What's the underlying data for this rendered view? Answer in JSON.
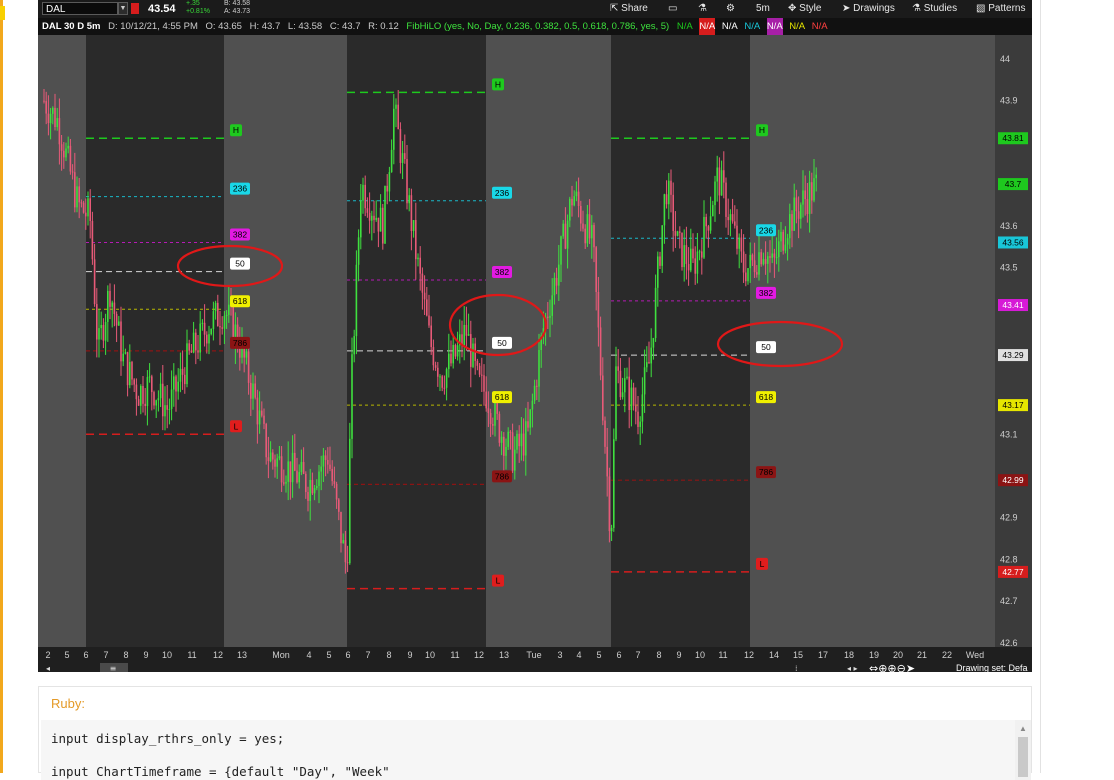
{
  "toolbar": {
    "symbol": "DAL",
    "last_price": "43.54",
    "net_change": "+.35",
    "net_change_pct": "+0.81%",
    "bid": "B: 43.58",
    "ask": "A: 43.73",
    "share_label": "Share",
    "timeframe_label": "5m",
    "style_label": "Style",
    "drawings_label": "Drawings",
    "studies_label": "Studies",
    "patterns_label": "Patterns"
  },
  "status_line": {
    "aggregation": "DAL 30 D 5m",
    "date": "D: 10/12/21, 4:55 PM",
    "open": "O: 43.65",
    "high": "H: 43.7",
    "low": "L: 43.58",
    "close": "C: 43.7",
    "range": "R: 0.12",
    "study": "FibHiLO (yes, No, Day, 0.236, 0.382, 0.5, 0.618, 0.786, yes, 5)",
    "na_values": [
      "N/A",
      "N/A",
      "N/A",
      "N/A",
      "N/A",
      "N/A",
      "N/A"
    ]
  },
  "chart_data": {
    "type": "candlestick",
    "symbol": "DAL",
    "ylim": [
      42.6,
      44.0
    ],
    "y_ticks": [
      "44",
      "43.9",
      "43.6",
      "43.5",
      "43.1",
      "42.9",
      "42.8",
      "42.7",
      "42.6"
    ],
    "price_badges": [
      {
        "label": "43.81",
        "color": "#1ec91e"
      },
      {
        "label": "43.7",
        "color": "#1ec91e"
      },
      {
        "label": "43.56",
        "color": "#19c6d8"
      },
      {
        "label": "43.41",
        "color": "#d61ad6"
      },
      {
        "label": "43.29",
        "color": "#e0e0e0"
      },
      {
        "label": "43.17",
        "color": "#e6e600"
      },
      {
        "label": "42.99",
        "color": "#8b1414"
      },
      {
        "label": "42.77",
        "color": "#d61d1d"
      }
    ],
    "x_tick_labels": [
      "2",
      "5",
      "6",
      "7",
      "8",
      "9",
      "10",
      "11",
      "12",
      "13",
      "Mon",
      "4",
      "5",
      "6",
      "7",
      "8",
      "9",
      "10",
      "11",
      "12",
      "13",
      "Tue",
      "3",
      "4",
      "5",
      "6",
      "7",
      "8",
      "9",
      "10",
      "11",
      "12",
      "14",
      "15",
      "17",
      "18",
      "19",
      "20",
      "21",
      "22",
      "Wed"
    ],
    "fib_levels": [
      {
        "day": 1,
        "high": 43.81,
        "r236": 43.67,
        "r382": 43.56,
        "r50": 43.49,
        "r618": 43.4,
        "r786": 43.3,
        "low": 43.1,
        "labels": [
          "H",
          "236",
          "382",
          "50",
          "618",
          "786",
          "L"
        ]
      },
      {
        "day": 2,
        "high": 43.92,
        "r236": 43.66,
        "r382": 43.47,
        "r50": 43.3,
        "r618": 43.17,
        "r786": 42.98,
        "low": 42.73,
        "labels": [
          "H",
          "236",
          "382",
          "50",
          "618",
          "786",
          "L"
        ]
      },
      {
        "day": 3,
        "high": 43.81,
        "r236": 43.57,
        "r382": 43.42,
        "r50": 43.29,
        "r618": 43.17,
        "r786": 42.99,
        "low": 42.77,
        "labels": [
          "H",
          "236",
          "382",
          "50",
          "618",
          "786",
          "L"
        ]
      }
    ],
    "day_sessions": [
      {
        "start": 0,
        "high": 43.92,
        "low": 43.1,
        "open": 43.85,
        "close": 43.37
      },
      {
        "start": 1,
        "high": 43.9,
        "low": 42.73,
        "open": 42.78,
        "close": 43.24
      },
      {
        "start": 2,
        "high": 43.81,
        "low": 42.77,
        "open": 42.85,
        "close": 43.7
      }
    ]
  },
  "drawing_set_label": "Drawing set: Defa",
  "code_block": {
    "language": "Ruby:",
    "line1": "input display_rthrs_only = yes;",
    "line2": "input ChartTimeframe = {default \"Day\", \"Week\""
  }
}
